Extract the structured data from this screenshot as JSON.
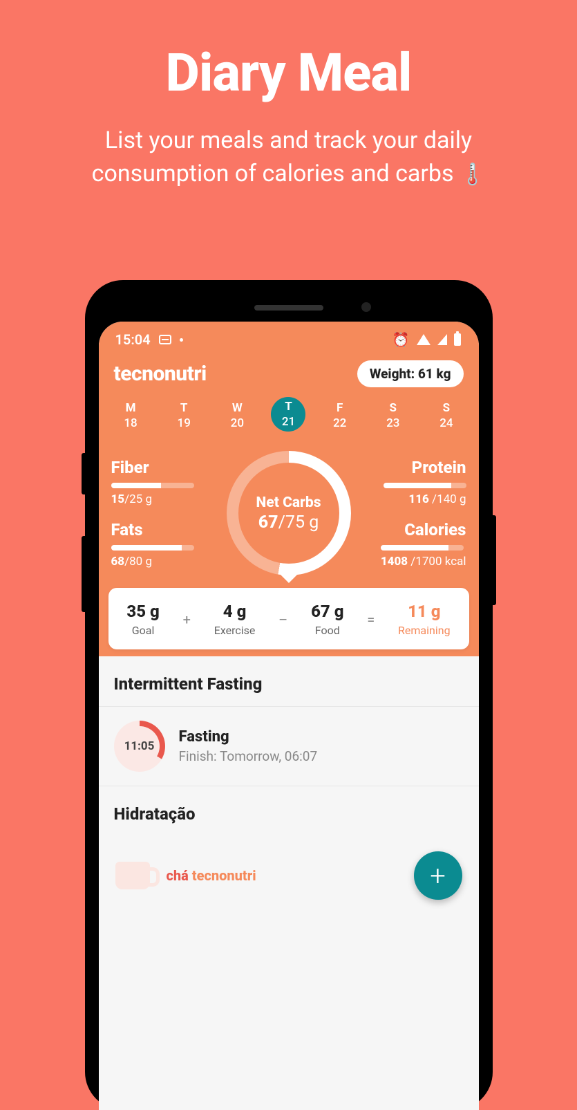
{
  "hero": {
    "title": "Diary Meal",
    "subtitle": "List your meals and track your daily consumption of calories and carbs",
    "emoji": "🌡️"
  },
  "status": {
    "time": "15:04"
  },
  "app": {
    "logo": "tecnonutri",
    "weight_label": "Weight: 61 kg"
  },
  "days": [
    {
      "label": "M",
      "num": "18",
      "active": false
    },
    {
      "label": "T",
      "num": "19",
      "active": false
    },
    {
      "label": "W",
      "num": "20",
      "active": false
    },
    {
      "label": "T",
      "num": "21",
      "active": true
    },
    {
      "label": "F",
      "num": "22",
      "active": false
    },
    {
      "label": "S",
      "num": "23",
      "active": false
    },
    {
      "label": "S",
      "num": "24",
      "active": false
    }
  ],
  "macros": {
    "fiber": {
      "label": "Fiber",
      "current": "15",
      "goal": "/25 g",
      "pct": 60
    },
    "fats": {
      "label": "Fats",
      "current": "68",
      "goal": "/80 g",
      "pct": 85
    },
    "protein": {
      "label": "Protein",
      "current": "116",
      "goal": " /140 g",
      "pct": 82
    },
    "calories": {
      "label": "Calories",
      "current": "1408",
      "goal": " /1700 kcal",
      "pct": 82
    }
  },
  "ring": {
    "label": "Net Carbs",
    "current": "67",
    "goal": "/75 g"
  },
  "summary": {
    "goal": {
      "val": "35 g",
      "lbl": "Goal"
    },
    "exercise": {
      "val": "4 g",
      "lbl": "Exercise"
    },
    "food": {
      "val": "67 g",
      "lbl": "Food"
    },
    "remaining": {
      "val": "11 g",
      "lbl": "Remaining"
    },
    "ops": {
      "plus": "+",
      "minus": "–",
      "eq": "="
    }
  },
  "fasting": {
    "section_title": "Intermittent Fasting",
    "time": "11:05",
    "title": "Fasting",
    "subtitle": "Finish: Tomorrow, 06:07"
  },
  "hydration": {
    "section_title": "Hidratação",
    "brand_cha": "chá",
    "brand_tn": " tecnonutri"
  },
  "fab": {
    "label": "+"
  }
}
